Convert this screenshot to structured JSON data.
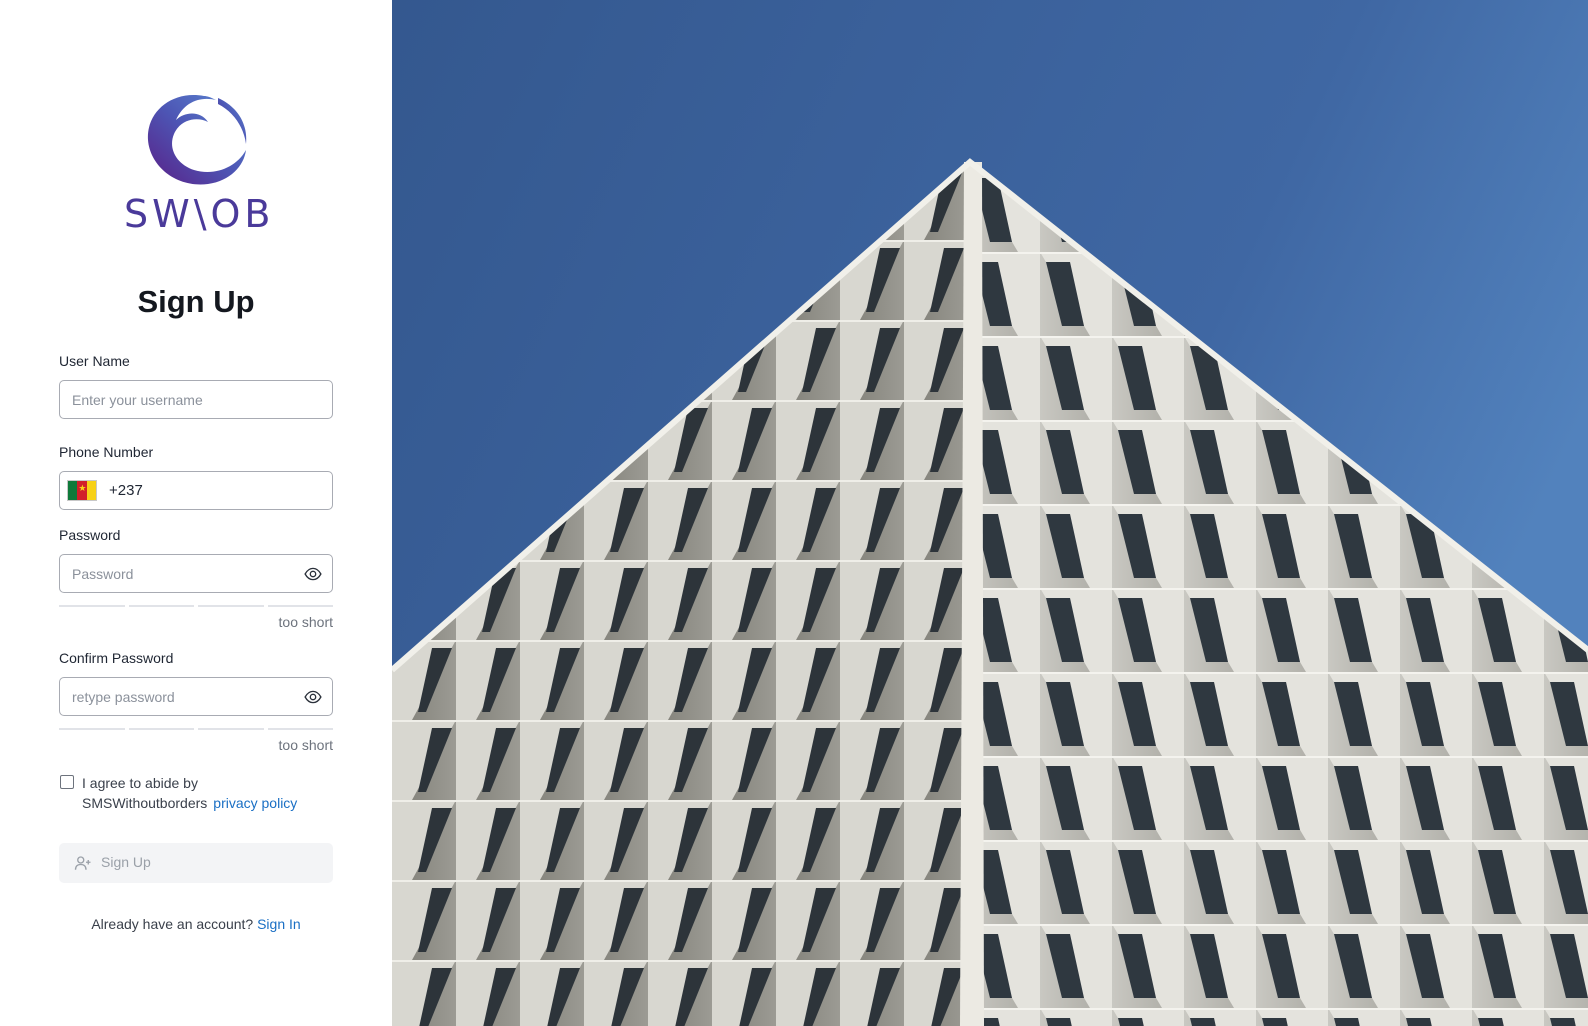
{
  "brand": {
    "logo_text": "SW\\OB"
  },
  "page_title": "Sign Up",
  "username": {
    "label": "User Name",
    "placeholder": "Enter your username"
  },
  "phone": {
    "label": "Phone Number",
    "country_code": "+237",
    "flag_icon": "cameroon-flag-icon"
  },
  "password": {
    "label": "Password",
    "placeholder": "Password",
    "strength_text": "too short",
    "strength_level": 0
  },
  "confirm_password": {
    "label": "Confirm Password",
    "placeholder": "retype password",
    "strength_text": "too short",
    "strength_level": 0
  },
  "agreement": {
    "text": "I agree to abide by SMSWithoutborders",
    "link_text": "privacy policy",
    "checked": false
  },
  "submit": {
    "label": "Sign Up",
    "icon": "user-plus-icon",
    "disabled": true
  },
  "footer": {
    "text": "Already have an account?",
    "link_text": "Sign In"
  },
  "colors": {
    "link": "#1a6fc4",
    "logo_purple": "#4a3a9a",
    "sky": "#3f69a3"
  },
  "hero_image": {
    "subject": "building-facade-photo"
  }
}
